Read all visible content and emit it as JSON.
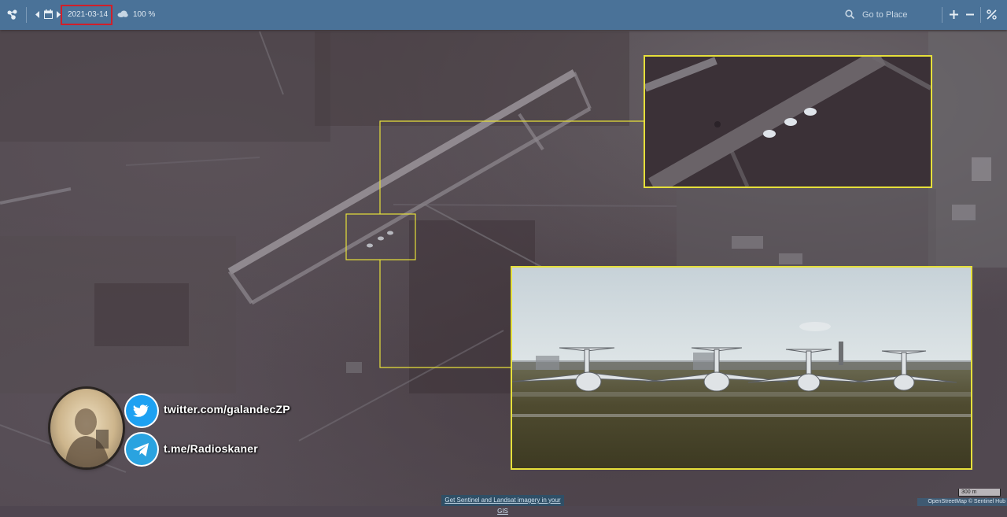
{
  "toolbar": {
    "settings_icon": "share-nodes-icon",
    "prev_icon": "caret-left-icon",
    "calendar_icon": "calendar-icon",
    "next_icon": "caret-right-icon",
    "date": "2021-03-14",
    "cloud_icon": "cloud-icon",
    "cloud_coverage": "100 %",
    "search_icon": "search-icon",
    "search_placeholder": "Go to Place",
    "zoom_in_icon": "plus-icon",
    "zoom_out_icon": "minus-icon",
    "tools_icon": "tools-icon"
  },
  "highlight_color": "#d01f2a",
  "inset_color": "#e6e03a",
  "social": [
    {
      "icon": "twitter-icon",
      "text": "twitter.com/galandecZP",
      "color": "#1da1f2"
    },
    {
      "icon": "telegram-icon",
      "text": "t.me/Radioskaner",
      "color": "#2aa3e0"
    }
  ],
  "footer": {
    "promo_link": "Get Sentinel and Landsat imagery in your GIS",
    "scale_label": "300 m",
    "attribution": "OpenStreetMap  © Sentinel Hub"
  }
}
